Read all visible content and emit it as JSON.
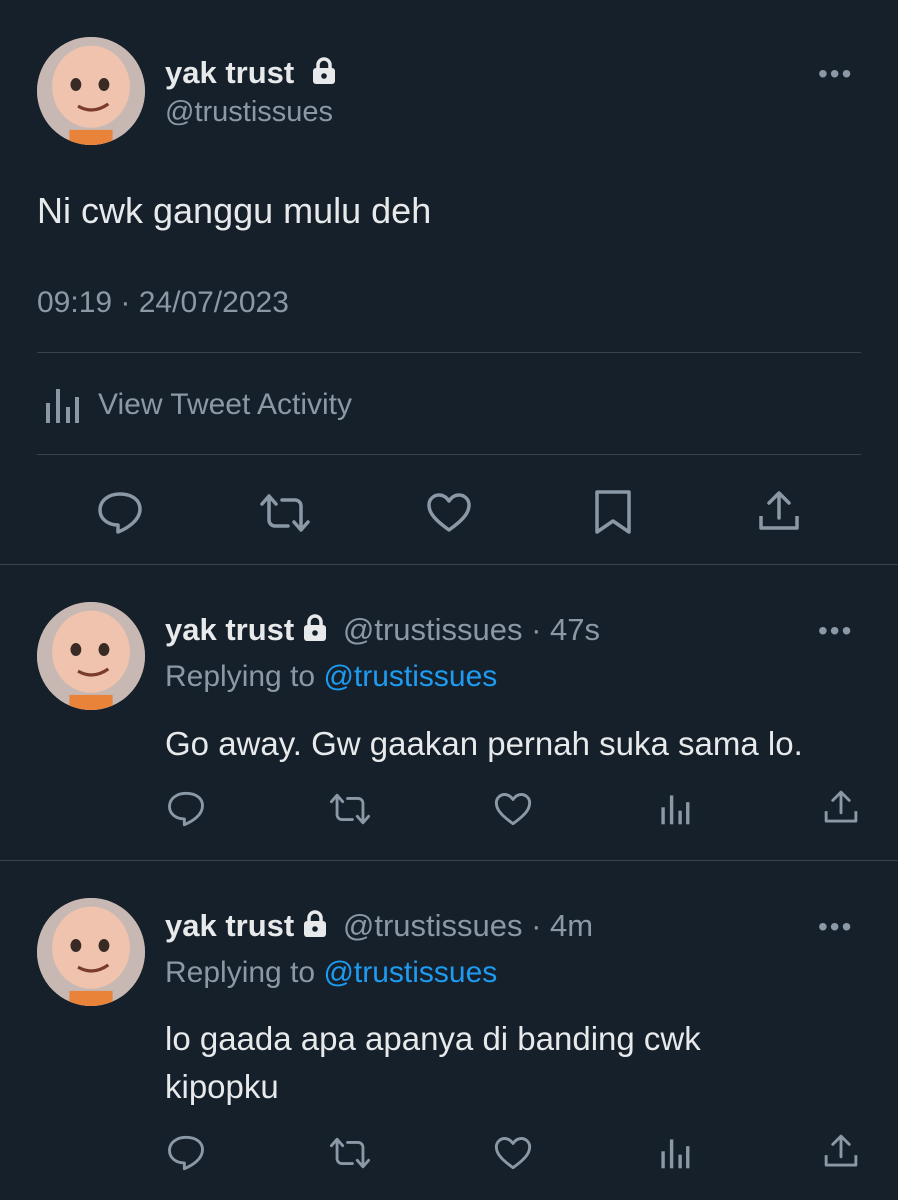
{
  "main_tweet": {
    "display_name": "yak trust",
    "handle": "@trustissues",
    "text": "Ni cwk ganggu mulu deh",
    "timestamp": "09:19 · 24/07/2023",
    "activity_label": "View Tweet Activity",
    "more_label": "•••"
  },
  "replies": [
    {
      "display_name": "yak trust",
      "handle": "@trustissues",
      "time": "· 47s",
      "replying_prefix": "Replying to",
      "replying_handle": "@trustissues",
      "text_lines": [
        "Go away. Gw gaakan pernah suka sama lo."
      ],
      "more_label": "•••"
    },
    {
      "display_name": "yak trust",
      "handle": "@trustissues",
      "time": "· 4m",
      "replying_prefix": "Replying to",
      "replying_handle": "@trustissues",
      "text_lines": [
        "lo gaada apa apanya di banding cwk",
        "kipopku"
      ],
      "more_label": "•••"
    }
  ],
  "icons": {
    "lock": "lock-icon",
    "reply": "reply-icon",
    "retweet": "retweet-icon",
    "like": "heart-icon",
    "bookmark": "bookmark-icon",
    "share": "share-icon",
    "analytics": "analytics-icon",
    "more": "more-icon"
  },
  "colors": {
    "background": "#15202b",
    "text": "#e7e9ea",
    "muted": "#8b98a5",
    "link": "#1d9bf0",
    "divider": "#38444d"
  }
}
